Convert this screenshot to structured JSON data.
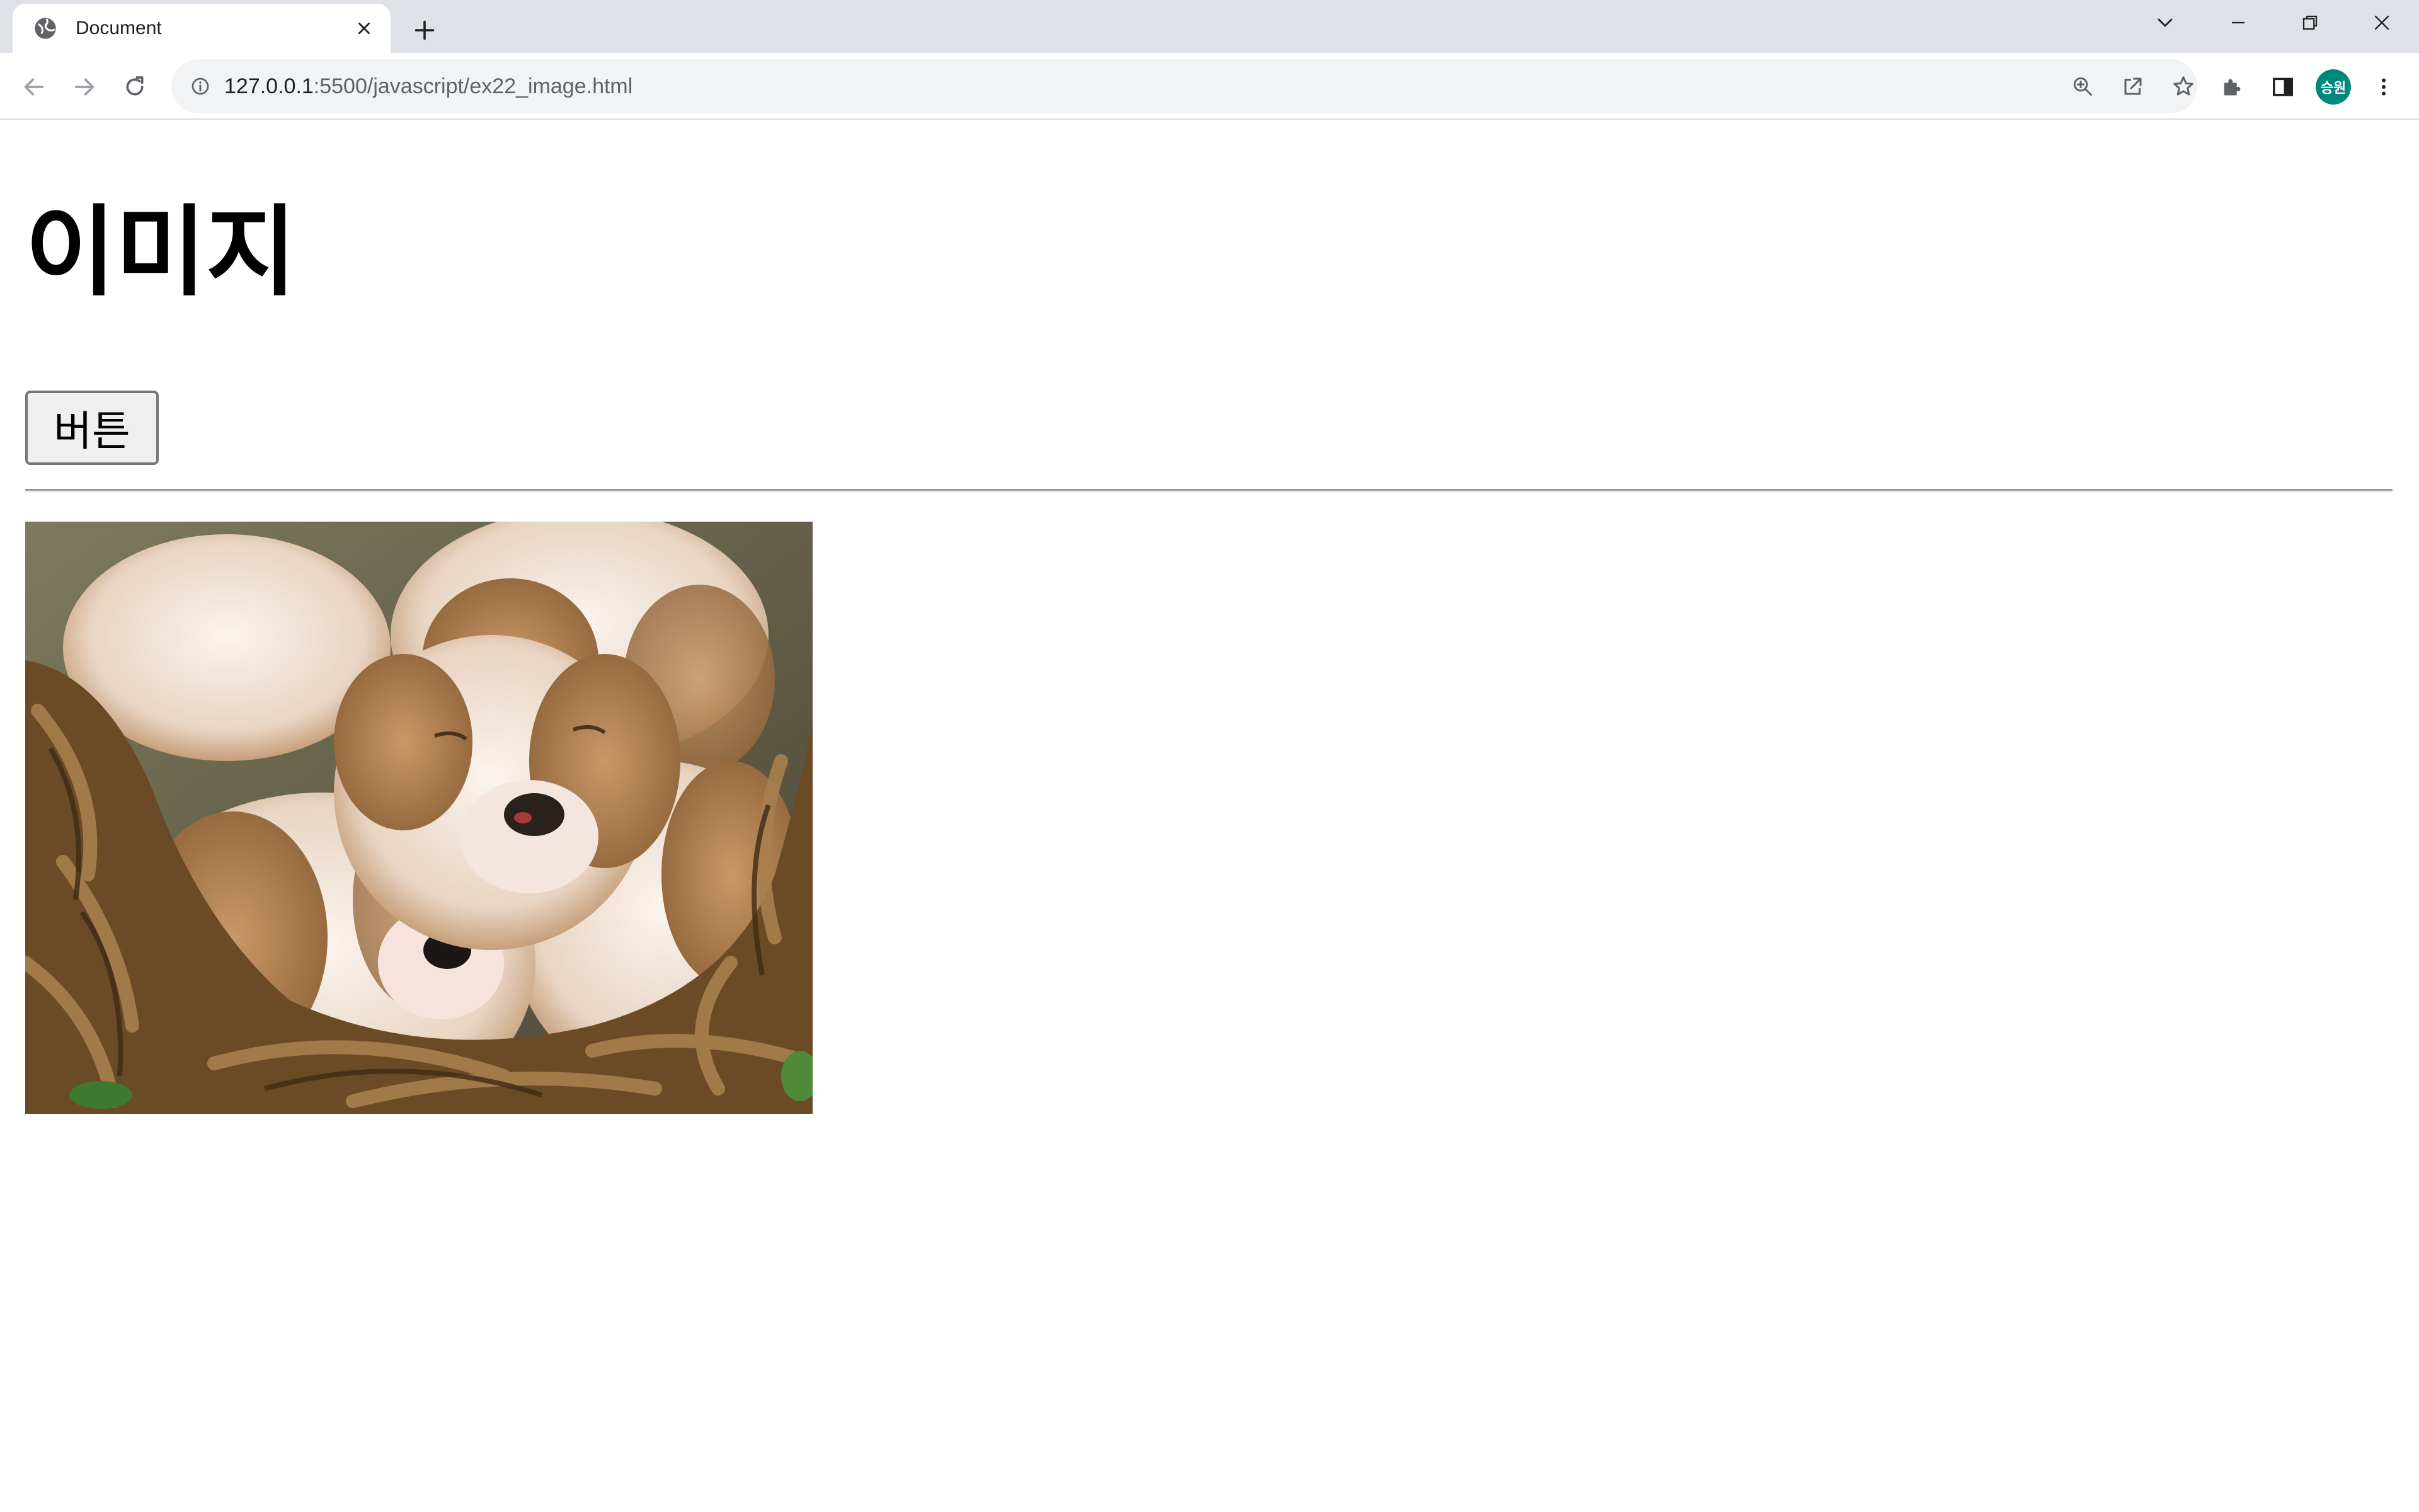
{
  "browser": {
    "tab": {
      "title": "Document",
      "favicon": "globe-icon"
    },
    "omnibox": {
      "url_host": "127.0.0.1",
      "url_path": ":5500/javascript/ex22_image.html"
    },
    "profile": {
      "initials": "승원",
      "color": "#00897b"
    }
  },
  "page": {
    "heading": "이미지",
    "button_label": "버튼",
    "image": {
      "description_icon": "puppies-photo"
    }
  }
}
